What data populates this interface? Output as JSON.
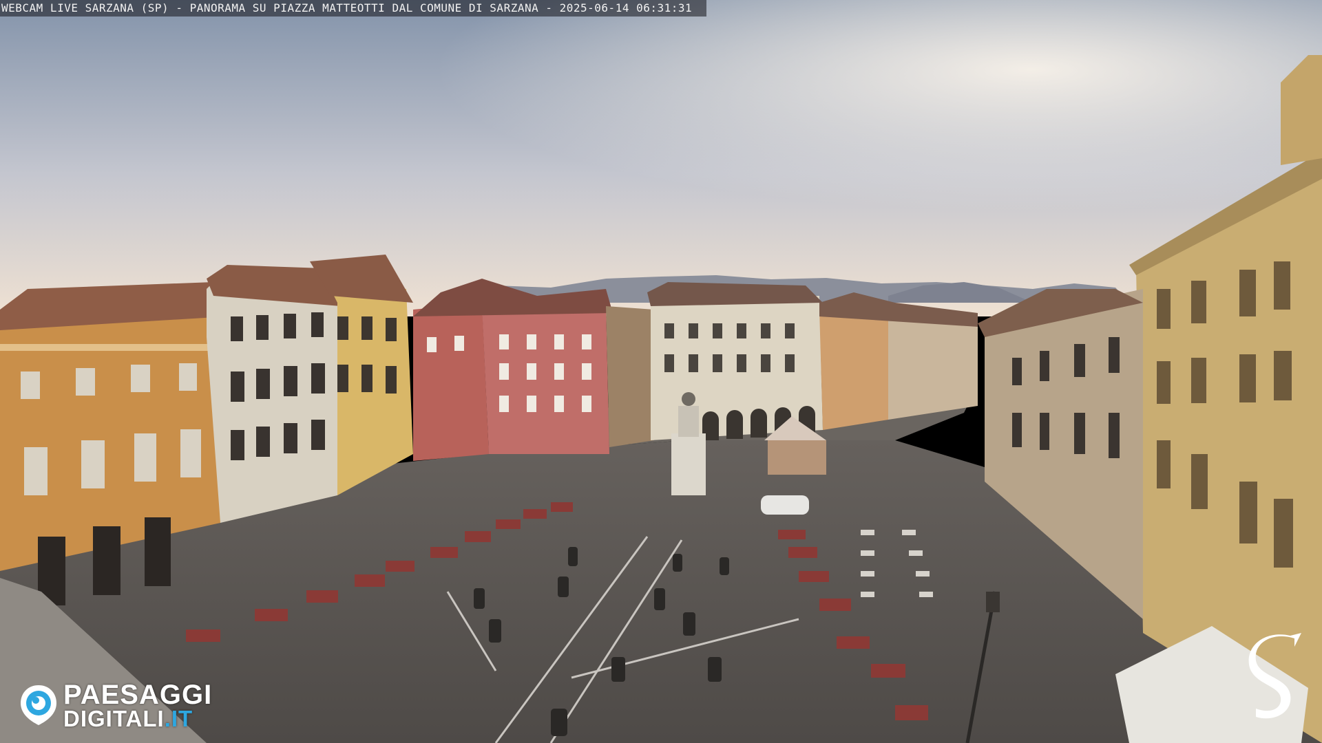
{
  "overlay": {
    "caption": "WEBCAM LIVE SARZANA (SP) - PANORAMA SU PIAZZA MATTEOTTI DAL COMUNE DI SARZANA - 2025-06-14  06:31:31"
  },
  "logo": {
    "line1": "PAESAGGI",
    "line2_main": "DIGITALI",
    "line2_tld": ".IT",
    "accent_color": "#2ea7e0"
  },
  "brand_mark": {
    "icon": "stylized-s-icon"
  },
  "colors": {
    "sky_top": "#7f90a8",
    "sky_horizon": "#f3e6d8",
    "plaza": "#5b5754"
  }
}
